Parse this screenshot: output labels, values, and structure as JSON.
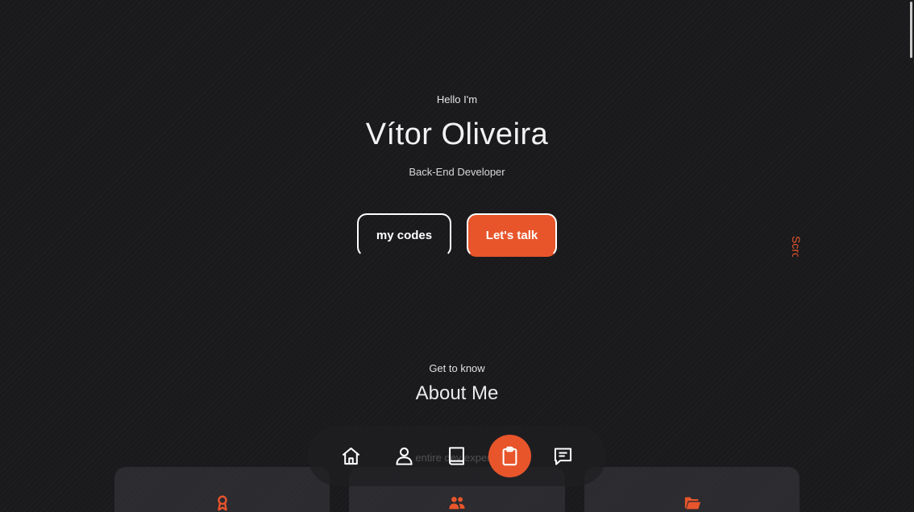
{
  "hero": {
    "greeting": "Hello I'm",
    "name": "Vítor Oliveira",
    "role": "Back-End Developer",
    "codes_label": "my codes",
    "talk_label": "Let's talk",
    "scroll_label": "Scroll Down"
  },
  "about": {
    "subtitle": "Get to know",
    "title": "About Me",
    "text": "entire dev experie"
  },
  "cards": [
    {
      "icon": "award-icon"
    },
    {
      "icon": "users-icon"
    },
    {
      "icon": "folder-icon"
    }
  ],
  "nav": {
    "items": [
      {
        "icon": "home-icon"
      },
      {
        "icon": "user-icon"
      },
      {
        "icon": "book-icon"
      },
      {
        "icon": "clipboard-icon",
        "active": true
      },
      {
        "icon": "message-icon"
      }
    ]
  },
  "colors": {
    "accent": "#e8552b",
    "background": "#1a1a1d",
    "text": "#ffffff"
  }
}
